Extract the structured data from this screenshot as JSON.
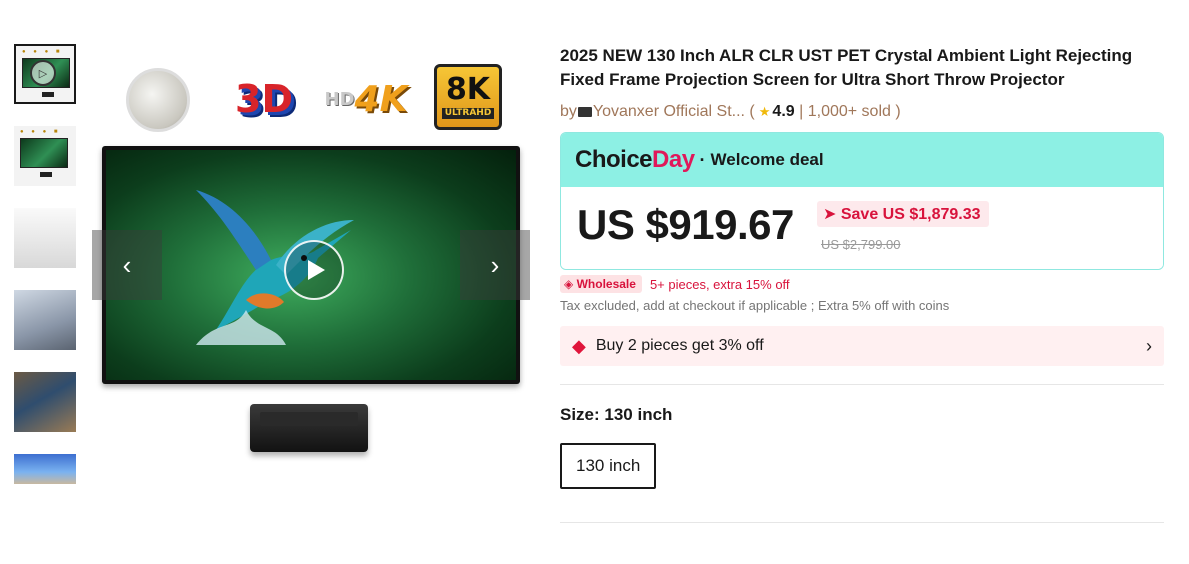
{
  "product": {
    "title": "2025 NEW 130 Inch ALR CLR UST PET Crystal Ambient Light Rejecting Fixed Frame Projection Screen for Ultra Short Throw Projector",
    "store_prefix": "by",
    "store_name": "Yovanxer Official St...",
    "rating": "4.9",
    "sold": "1,000+ sold"
  },
  "gallery": {
    "badges": {
      "three_d": "3D",
      "four_k_prefix": "HD",
      "four_k": "4K",
      "eight_k": "8K",
      "eight_k_sub": "ULTRAHD"
    },
    "prev_icon": "chevron-left-icon",
    "next_icon": "chevron-right-icon",
    "play_icon": "play-icon",
    "active_thumb": 0
  },
  "deal": {
    "choice": "Choice",
    "day": "Day",
    "separator": "·",
    "welcome": "Welcome deal",
    "price": "US $919.67",
    "save": "Save US $1,879.33",
    "original_price": "US $2,799.00"
  },
  "wholesale": {
    "tag": "Wholesale",
    "text": "5+ pieces, extra 15% off"
  },
  "tax_note": "Tax excluded, add at checkout if applicable ; Extra 5% off with coins",
  "promo": {
    "text": "Buy 2 pieces get 3% off"
  },
  "size": {
    "label": "Size: 130 inch",
    "options": [
      "130 inch"
    ]
  },
  "colors": {
    "accent_red": "#d8133c",
    "choice_teal": "#8df0e4",
    "store_brown": "#a0775a"
  }
}
